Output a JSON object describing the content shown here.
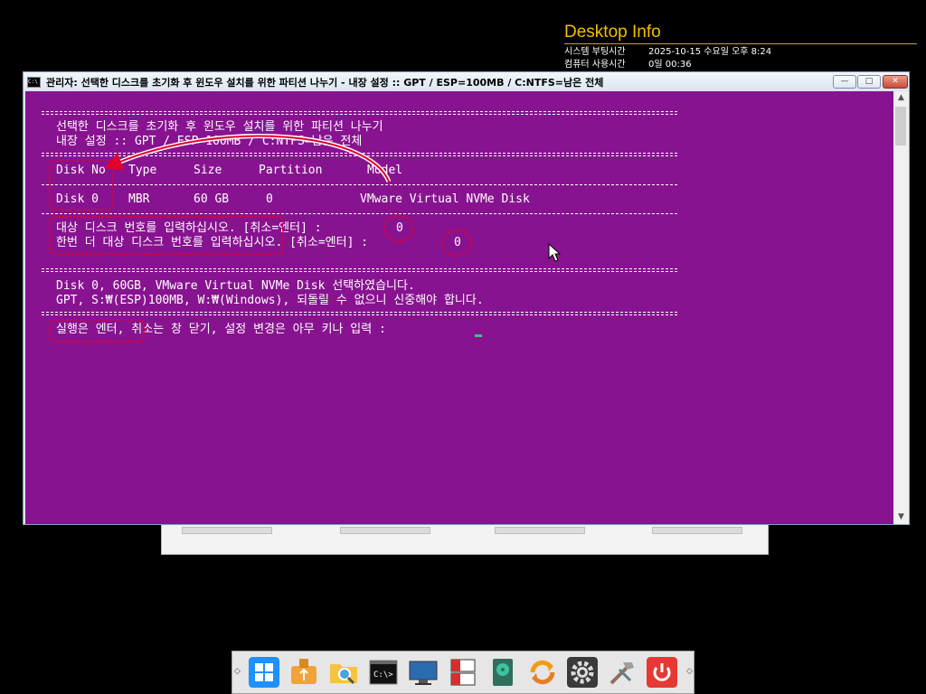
{
  "desktop_info": {
    "title": "Desktop Info",
    "rows": [
      {
        "label": "시스템 부팅시간",
        "value": "2025-10-15 수요일 오후 8:24"
      },
      {
        "label": "컴퓨터 사용시간",
        "value": "0일 00:36"
      }
    ]
  },
  "window": {
    "title": "관리자:  선택한 디스크를 초기화 후 윈도우 설치를 위한 파티션 나누기 - 내장 설정 :: GPT / ESP=100MB / C:NTFS=남은 전체",
    "icon_text": "C:\\",
    "buttons": {
      "minimize": "—",
      "maximize": "□",
      "close": "✕"
    }
  },
  "console": {
    "heading1": "선택한 디스크를 초기화 후 윈도우 설치를 위한 파티션 나누기",
    "heading2": "내장 설정 :: GPT / ESP=100MB / C:NTFS=남은 전체",
    "table_headers": [
      "Disk No",
      "Type",
      "Size",
      "Partition",
      "Model"
    ],
    "table_row": [
      "Disk 0",
      "MBR",
      "60 GB",
      "0",
      "VMware Virtual NVMe Disk"
    ],
    "prompt1": "대상 디스크 번호를 입력하십시오. [취소=엔터] :",
    "prompt1_value": "0",
    "prompt2": "한번 더 대상 디스크 번호를 입력하십시오. [취소=엔터] :",
    "prompt2_value": "0",
    "summary1": "Disk 0, 60GB, VMware Virtual NVMe Disk 선택하였습니다.",
    "summary2": "GPT, S:₩(ESP)100MB, W:₩(Windows), 되돌릴 수 없으니 신중해야 합니다.",
    "final_prompt": "실행은 엔터, 취소는 창 닫기, 설정 변경은 아무 키나 입력 :"
  },
  "colors": {
    "console_bg": "#881390",
    "annotation": "#e4002b",
    "cursor": "#2ecc71",
    "desktop_info_title": "#f0c000"
  },
  "taskbar": {
    "icons": [
      "windows-start-icon",
      "usb-drive-icon",
      "folder-search-icon",
      "command-prompt-icon",
      "monitor-icon",
      "disk-manager-icon",
      "hard-disk-icon",
      "sync-icon",
      "settings-gear-icon",
      "tools-icon",
      "power-icon"
    ]
  }
}
